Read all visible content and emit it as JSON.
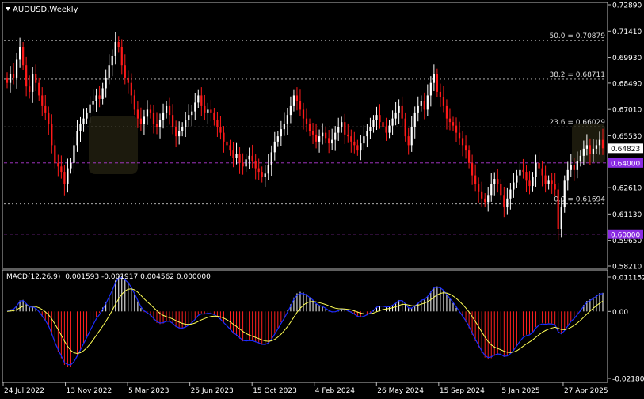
{
  "window": {
    "title": "AUDUSD,Weekly"
  },
  "chart_data": [
    {
      "type": "candlestick",
      "symbol": "AUDUSD",
      "timeframe": "Weekly",
      "title": "AUDUSD,Weekly",
      "ylim": [
        0.5821,
        0.7289
      ],
      "y_ticks": [
        "0.72890",
        "0.71410",
        "0.69930",
        "0.68490",
        "0.67010",
        "0.65530",
        "0.64090",
        "0.62610",
        "0.61130",
        "0.59650",
        "0.58210"
      ],
      "x_ticks": [
        "24 Jul 2022",
        "13 Nov 2022",
        "5 Mar 2023",
        "25 Jun 2023",
        "15 Oct 2023",
        "4 Feb 2024",
        "26 May 2024",
        "15 Sep 2024",
        "5 Jan 2025",
        "27 Apr 2025"
      ],
      "current_price": "0.64823",
      "fib_levels": [
        {
          "label": "50.0 = 0.70879",
          "value": 0.70879
        },
        {
          "label": "38.2 = 0.68711",
          "value": 0.68711
        },
        {
          "label": "23.6 = 0.66029",
          "value": 0.66029
        },
        {
          "label": "0.0 = 0.61694",
          "value": 0.61694
        }
      ],
      "horizontal_levels": [
        {
          "label": "0.64000",
          "value": 0.64
        },
        {
          "label": "0.60000",
          "value": 0.6
        }
      ],
      "closes": [
        0.685,
        0.69,
        0.688,
        0.698,
        0.705,
        0.695,
        0.683,
        0.68,
        0.69,
        0.685,
        0.678,
        0.672,
        0.668,
        0.662,
        0.65,
        0.64,
        0.638,
        0.635,
        0.628,
        0.637,
        0.64,
        0.65,
        0.658,
        0.662,
        0.665,
        0.668,
        0.673,
        0.675,
        0.678,
        0.676,
        0.682,
        0.688,
        0.695,
        0.7,
        0.708,
        0.705,
        0.695,
        0.688,
        0.685,
        0.678,
        0.67,
        0.665,
        0.662,
        0.666,
        0.67,
        0.668,
        0.662,
        0.66,
        0.664,
        0.668,
        0.672,
        0.667,
        0.66,
        0.655,
        0.658,
        0.66,
        0.664,
        0.667,
        0.669,
        0.674,
        0.678,
        0.672,
        0.668,
        0.67,
        0.668,
        0.664,
        0.66,
        0.657,
        0.652,
        0.65,
        0.647,
        0.643,
        0.645,
        0.64,
        0.638,
        0.642,
        0.644,
        0.641,
        0.637,
        0.635,
        0.632,
        0.634,
        0.639,
        0.646,
        0.652,
        0.655,
        0.659,
        0.662,
        0.667,
        0.672,
        0.678,
        0.675,
        0.67,
        0.665,
        0.662,
        0.658,
        0.656,
        0.652,
        0.655,
        0.657,
        0.654,
        0.651,
        0.653,
        0.657,
        0.66,
        0.663,
        0.656,
        0.655,
        0.652,
        0.65,
        0.647,
        0.651,
        0.655,
        0.658,
        0.66,
        0.664,
        0.667,
        0.663,
        0.66,
        0.657,
        0.661,
        0.665,
        0.668,
        0.672,
        0.665,
        0.655,
        0.65,
        0.66,
        0.668,
        0.672,
        0.675,
        0.67,
        0.678,
        0.685,
        0.69,
        0.68,
        0.677,
        0.672,
        0.665,
        0.663,
        0.661,
        0.657,
        0.654,
        0.65,
        0.647,
        0.64,
        0.633,
        0.628,
        0.624,
        0.62,
        0.618,
        0.622,
        0.628,
        0.631,
        0.628,
        0.622,
        0.615,
        0.62,
        0.625,
        0.629,
        0.633,
        0.636,
        0.635,
        0.63,
        0.627,
        0.632,
        0.64,
        0.637,
        0.633,
        0.628,
        0.63,
        0.628,
        0.625,
        0.603,
        0.615,
        0.63,
        0.636,
        0.639,
        0.636,
        0.641,
        0.644,
        0.648,
        0.65,
        0.645,
        0.648,
        0.65,
        0.653,
        0.64823
      ],
      "macd": {
        "label": "MACD(12,26,9)",
        "values": "0.001593 -0.001917 0.004562 0.000000",
        "ylim": [
          -0.021809,
          0.011152
        ],
        "y_ticks": [
          "0.011152",
          "0.00",
          "-0.021809"
        ]
      },
      "colors": {
        "bull": "#ffffff",
        "bear": "#ff1a1a",
        "signal_line": "#ffff55",
        "macd_line": "#1a2cff",
        "fib": "#c8c8c8",
        "level": "#b33bd8",
        "level_tag_bg": "#8a2be2"
      }
    }
  ]
}
